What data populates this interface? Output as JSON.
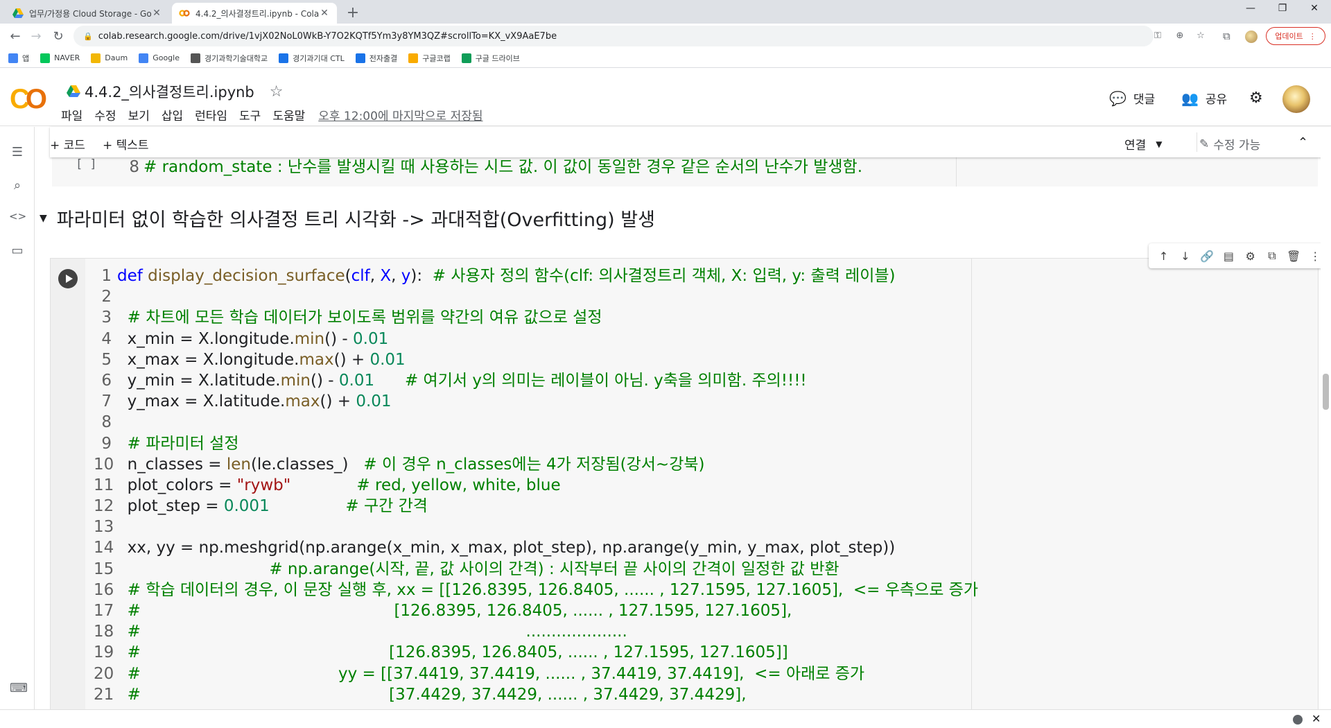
{
  "browser": {
    "tabs": [
      {
        "label": "업무/가정용 Cloud Storage - Go"
      },
      {
        "label": "4.4.2_의사결정트리.ipynb - Cola"
      }
    ],
    "new_tab": "+",
    "window_controls": {
      "minimize": "—",
      "restore": "❐",
      "close": "✕"
    },
    "url": "colab.research.google.com/drive/1vjX02NoL0WkB-Y7O2KQTf5Ym3y8YM3QZ#scrollTo=KX_vX9AaE7be",
    "update_label": "업데이트",
    "bookmarks": [
      {
        "label": "앱",
        "icon": "apps-grid-icon",
        "color": "#4285f4"
      },
      {
        "label": "NAVER",
        "icon": "naver-icon",
        "color": "#03c75a"
      },
      {
        "label": "Daum",
        "icon": "daum-icon",
        "color": "#f2b705"
      },
      {
        "label": "Google",
        "icon": "google-icon",
        "color": "#4285f4"
      },
      {
        "label": "경기과학기술대학교",
        "icon": "school-icon",
        "color": "#555555"
      },
      {
        "label": "경기과기대 CTL",
        "icon": "ctl-icon",
        "color": "#1a73e8"
      },
      {
        "label": "전자출결",
        "icon": "checkbox-icon",
        "color": "#1a73e8"
      },
      {
        "label": "구글코랩",
        "icon": "colab-icon",
        "color": "#f9ab00"
      },
      {
        "label": "구글 드라이브",
        "icon": "drive-icon",
        "color": "#0f9d58"
      }
    ]
  },
  "colab": {
    "logo": "CO",
    "notebook_title": "4.4.2_의사결정트리.ipynb",
    "menu": [
      "파일",
      "수정",
      "보기",
      "삽입",
      "런타임",
      "도구",
      "도움말"
    ],
    "saved_status": "오후 12:00에 마지막으로 저장됨",
    "comment_label": "댓글",
    "share_label": "공유",
    "toolbar": {
      "add_code": "+ 코드",
      "add_text": "+ 텍스트",
      "connect": "연결",
      "edit_mode": "수정 가능"
    }
  },
  "prev_cell": {
    "bracket": "[ ]",
    "line_number": "8",
    "code": "# random_state : 난수를 발생시킬 때 사용하는 시드 값. 이 값이 동일한 경우 같은 순서의 난수가 발생함."
  },
  "section_heading": "파라미터 없이 학습한 의사결정 트리 시각화 -> 과대적합(Overfitting) 발생",
  "code_cell": {
    "lines": [
      {
        "n": "1",
        "parts": [
          [
            "kw",
            "def "
          ],
          [
            "fn",
            "display_decision_surface"
          ],
          [
            "",
            "("
          ],
          [
            "kw",
            "clf"
          ],
          [
            "",
            ", "
          ],
          [
            "kw",
            "X"
          ],
          [
            "",
            ", "
          ],
          [
            "kw",
            "y"
          ],
          [
            "",
            "):  "
          ],
          [
            "cm",
            "# 사용자 정의 함수(clf: 의사결정트리 객체, X: 입력, y: 출력 레이블)"
          ]
        ]
      },
      {
        "n": "2",
        "parts": []
      },
      {
        "n": "3",
        "parts": [
          [
            "",
            "  "
          ],
          [
            "cm",
            "# 차트에 모든 학습 데이터가 보이도록 범위를 약간의 여유 값으로 설정"
          ]
        ]
      },
      {
        "n": "4",
        "parts": [
          [
            "",
            "  x_min = X.longitude."
          ],
          [
            "fn",
            "min"
          ],
          [
            "",
            "() - "
          ],
          [
            "nm",
            "0.01"
          ]
        ]
      },
      {
        "n": "5",
        "parts": [
          [
            "",
            "  x_max = X.longitude."
          ],
          [
            "fn",
            "max"
          ],
          [
            "",
            "() + "
          ],
          [
            "nm",
            "0.01"
          ]
        ]
      },
      {
        "n": "6",
        "parts": [
          [
            "",
            "  y_min = X.latitude."
          ],
          [
            "fn",
            "min"
          ],
          [
            "",
            "() - "
          ],
          [
            "nm",
            "0.01"
          ],
          [
            "",
            "      "
          ],
          [
            "cm",
            "# 여기서 y의 의미는 레이블이 아님. y축을 의미함. 주의!!!!"
          ]
        ]
      },
      {
        "n": "7",
        "parts": [
          [
            "",
            "  y_max = X.latitude."
          ],
          [
            "fn",
            "max"
          ],
          [
            "",
            "() + "
          ],
          [
            "nm",
            "0.01"
          ]
        ]
      },
      {
        "n": "8",
        "parts": []
      },
      {
        "n": "9",
        "parts": [
          [
            "",
            "  "
          ],
          [
            "cm",
            "# 파라미터 설정"
          ]
        ]
      },
      {
        "n": "10",
        "parts": [
          [
            "",
            "  n_classes = "
          ],
          [
            "fn",
            "len"
          ],
          [
            "",
            "(le.classes_)   "
          ],
          [
            "cm",
            "# 이 경우 n_classes에는 4가 저장됨(강서~강북)"
          ]
        ]
      },
      {
        "n": "11",
        "parts": [
          [
            "",
            "  plot_colors = "
          ],
          [
            "st",
            "\"rywb\""
          ],
          [
            "",
            "             "
          ],
          [
            "cm",
            "# red, yellow, white, blue"
          ]
        ]
      },
      {
        "n": "12",
        "parts": [
          [
            "",
            "  plot_step = "
          ],
          [
            "nm",
            "0.001"
          ],
          [
            "",
            "               "
          ],
          [
            "cm",
            "# 구간 간격"
          ]
        ]
      },
      {
        "n": "13",
        "parts": []
      },
      {
        "n": "14",
        "parts": [
          [
            "",
            "  xx, yy = np.meshgrid(np.arange(x_min, x_max, plot_step), np.arange(y_min, y_max, plot_step))"
          ]
        ]
      },
      {
        "n": "15",
        "parts": [
          [
            "",
            "                              "
          ],
          [
            "cm",
            "# np.arange(시작, 끝, 값 사이의 간격) : 시작부터 끝 사이의 간격이 일정한 값 반환"
          ]
        ]
      },
      {
        "n": "16",
        "parts": [
          [
            "",
            "  "
          ],
          [
            "cm",
            "# 학습 데이터의 경우, 이 문장 실행 후, xx = [[126.8395, 126.8405, ...... , 127.1595, 127.1605],  <= 우측으로 증가"
          ]
        ]
      },
      {
        "n": "17",
        "parts": [
          [
            "",
            "  "
          ],
          [
            "cm",
            "#                                                  [126.8395, 126.8405, ...... , 127.1595, 127.1605],"
          ]
        ]
      },
      {
        "n": "18",
        "parts": [
          [
            "",
            "  "
          ],
          [
            "cm",
            "#                                                                            ...................."
          ]
        ]
      },
      {
        "n": "19",
        "parts": [
          [
            "",
            "  "
          ],
          [
            "cm",
            "#                                                 [126.8395, 126.8405, ...... , 127.1595, 127.1605]]"
          ]
        ]
      },
      {
        "n": "20",
        "parts": [
          [
            "",
            "  "
          ],
          [
            "cm",
            "#                                       yy = [[37.4419, 37.4419, ...... , 37.4419, 37.4419],  <= 아래로 증가"
          ]
        ]
      },
      {
        "n": "21",
        "parts": [
          [
            "",
            "  "
          ],
          [
            "cm",
            "#                                                 [37.4429, 37.4429, ...... , 37.4429, 37.4429],"
          ]
        ]
      }
    ]
  },
  "colors": {
    "keyword": "#0000ff",
    "function": "#795e26",
    "comment": "#008000",
    "number": "#09885a",
    "string": "#a31515",
    "update_red": "#d93025"
  }
}
